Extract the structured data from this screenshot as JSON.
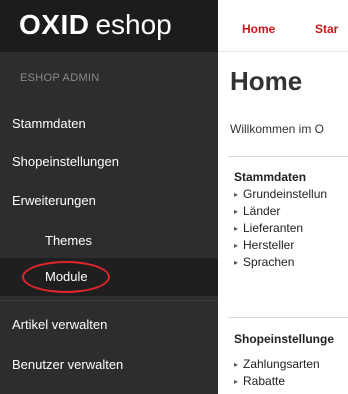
{
  "logo": {
    "strong": "OXID",
    "light": "eshop"
  },
  "sidebar": {
    "heading": "ESHOP ADMIN",
    "items": [
      {
        "label": "Stammdaten"
      },
      {
        "label": "Shopeinstellungen"
      },
      {
        "label": "Erweiterungen"
      },
      {
        "label": "Themes"
      },
      {
        "label": "Module"
      },
      {
        "label": "Artikel verwalten"
      },
      {
        "label": "Benutzer verwalten"
      }
    ]
  },
  "topnav": {
    "home": "Home",
    "start": "Star"
  },
  "main": {
    "title": "Home",
    "welcome": "Willkommen im O",
    "sections": [
      {
        "title": "Stammdaten",
        "links": [
          "Grundeinstellun",
          "Länder",
          "Lieferanten",
          "Hersteller",
          "Sprachen"
        ]
      },
      {
        "title": "Shopeinstellunge",
        "links": [
          "Zahlungsarten",
          "Rabatte"
        ]
      }
    ]
  },
  "colors": {
    "accent": "#c8161d",
    "highlight": "#e0252b",
    "sidebar_bg": "#2d2d2d"
  },
  "icons": {
    "link_bullet": "caret-right-icon"
  }
}
